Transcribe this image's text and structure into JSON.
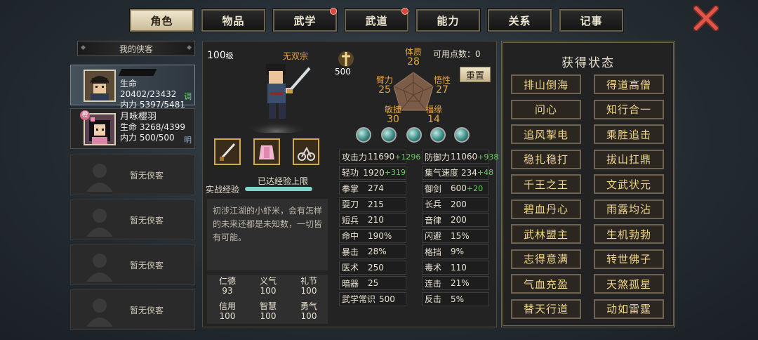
{
  "tabs": [
    {
      "label": "角色",
      "active": true,
      "badge": false
    },
    {
      "label": "物品",
      "active": false,
      "badge": false
    },
    {
      "label": "武学",
      "active": false,
      "badge": true
    },
    {
      "label": "武道",
      "active": false,
      "badge": true
    },
    {
      "label": "能力",
      "active": false,
      "badge": false
    },
    {
      "label": "关系",
      "active": false,
      "badge": false
    },
    {
      "label": "记事",
      "active": false,
      "badge": false
    }
  ],
  "sidebar": {
    "header": "我的侠客",
    "heroes": [
      {
        "name": "",
        "hp_label": "生命",
        "hp": "20402/23432",
        "mp_label": "内力",
        "mp": "5397/5481",
        "tag": "调"
      },
      {
        "name": "月咏樱羽",
        "hp_label": "生命",
        "hp": "3268/4399",
        "mp_label": "内力",
        "mp": "500/500",
        "tag": "明",
        "badge": "橙"
      }
    ],
    "empty_label": "暂无侠客"
  },
  "character": {
    "level": "100",
    "level_unit": "级",
    "sect": "无双宗",
    "exp_label": "实战经验",
    "exp_text": "已达经验上限",
    "bio": "初涉江湖的小虾米，会有怎样的未来还都是未知数，一切皆有可能。",
    "power": "500",
    "virtues": [
      {
        "k": "仁德",
        "v": "93"
      },
      {
        "k": "义气",
        "v": "100"
      },
      {
        "k": "礼节",
        "v": "100"
      },
      {
        "k": "信用",
        "v": "100"
      },
      {
        "k": "智慧",
        "v": "100"
      },
      {
        "k": "勇气",
        "v": "100"
      }
    ]
  },
  "attributes": {
    "free_points_label": "可用点数：",
    "free_points": "0",
    "reset_label": "重置",
    "tizhi": {
      "k": "体质",
      "v": "28"
    },
    "bili": {
      "k": "臂力",
      "v": "25"
    },
    "wuxing": {
      "k": "悟性",
      "v": "27"
    },
    "minjie": {
      "k": "敏捷",
      "v": "30"
    },
    "fuyuan": {
      "k": "福缘",
      "v": "14"
    }
  },
  "stats": [
    {
      "k": "攻击力",
      "v": "11690",
      "b": "+1296"
    },
    {
      "k": "防御力",
      "v": "11060",
      "b": "+938"
    },
    {
      "k": "轻功",
      "v": "1920",
      "b": "+319"
    },
    {
      "k": "集气速度",
      "v": "234",
      "b": "+48"
    },
    {
      "k": "拳掌",
      "v": "274",
      "b": ""
    },
    {
      "k": "御剑",
      "v": "600",
      "b": "+20"
    },
    {
      "k": "耍刀",
      "v": "215",
      "b": ""
    },
    {
      "k": "长兵",
      "v": "200",
      "b": ""
    },
    {
      "k": "短兵",
      "v": "210",
      "b": ""
    },
    {
      "k": "音律",
      "v": "200",
      "b": ""
    },
    {
      "k": "命中",
      "v": "190%",
      "b": ""
    },
    {
      "k": "闪避",
      "v": "15%",
      "b": ""
    },
    {
      "k": "暴击",
      "v": "28%",
      "b": ""
    },
    {
      "k": "格挡",
      "v": "9%",
      "b": ""
    },
    {
      "k": "医术",
      "v": "250",
      "b": ""
    },
    {
      "k": "毒术",
      "v": "110",
      "b": ""
    },
    {
      "k": "暗器",
      "v": "25",
      "b": ""
    },
    {
      "k": "连击",
      "v": "21%",
      "b": ""
    },
    {
      "k": "武学常识",
      "v": "500",
      "b": ""
    },
    {
      "k": "反击",
      "v": "5%",
      "b": ""
    }
  ],
  "status": {
    "title": "获得状态",
    "items": [
      "排山倒海",
      "得道高僧",
      "问心",
      "知行合一",
      "追风掣电",
      "乘胜追击",
      "稳扎稳打",
      "拔山扛鼎",
      "千王之王",
      "文武状元",
      "碧血丹心",
      "雨露均沾",
      "武林盟主",
      "生机勃勃",
      "志得意满",
      "转世佛子",
      "气血充盈",
      "天煞孤星",
      "替天行道",
      "动如雷霆"
    ]
  },
  "colors": {
    "accent_gold": "#f0d78a",
    "bonus_green": "#6ccb62",
    "attr_orange": "#e7a642"
  }
}
